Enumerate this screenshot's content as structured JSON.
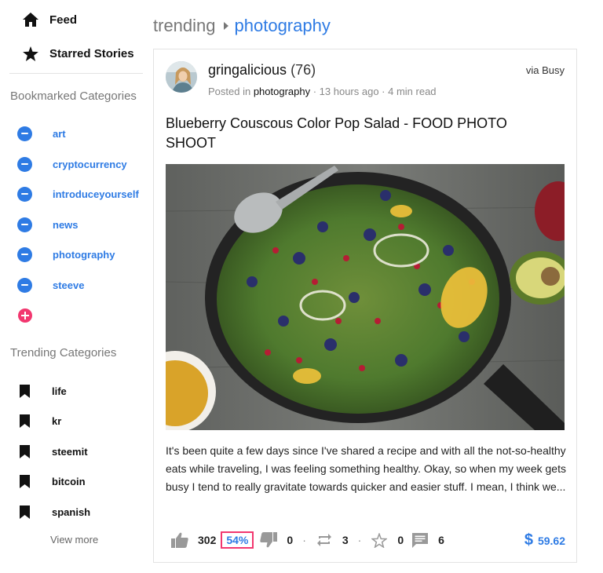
{
  "sidebar": {
    "top_nav": [
      {
        "label": "Feed",
        "icon": "home-icon"
      },
      {
        "label": "Starred Stories",
        "icon": "star-icon"
      }
    ],
    "bookmarked_title": "Bookmarked Categories",
    "bookmarked": [
      {
        "label": "art"
      },
      {
        "label": "cryptocurrency"
      },
      {
        "label": "introduceyourself"
      },
      {
        "label": "news"
      },
      {
        "label": "photography",
        "active": true
      },
      {
        "label": "steeve"
      }
    ],
    "trending_title": "Trending Categories",
    "trending": [
      {
        "label": "life"
      },
      {
        "label": "kr"
      },
      {
        "label": "steemit"
      },
      {
        "label": "bitcoin"
      },
      {
        "label": "spanish"
      }
    ],
    "view_more": "View more"
  },
  "breadcrumb": {
    "root": "trending",
    "current": "photography"
  },
  "post": {
    "author": "gringalicious",
    "reputation": "(76)",
    "posted_in_prefix": "Posted in ",
    "category": "photography",
    "time_info": " · 13 hours ago · 4 min read",
    "via": "via Busy",
    "title": "Blueberry Couscous Color Pop Salad - FOOD PHOTO SHOOT",
    "body": "It's been quite a few days since I've shared a recipe and with all the not-so-healthy eats while traveling, I was feeling something healthy. Okay, so when my week gets busy I tend to really gravitate towards quicker and easier stuff. I mean, I think we...",
    "actions": {
      "upvotes": "302",
      "upvote_percent": "54%",
      "downvotes": "0",
      "reblogs": "3",
      "stars": "0",
      "comments": "6",
      "payout_symbol": "$",
      "payout": "59.62"
    }
  },
  "colors": {
    "accent_blue": "#2e7be4",
    "highlight_pink": "#f2376f",
    "active_bg": "#e8f0fd"
  }
}
